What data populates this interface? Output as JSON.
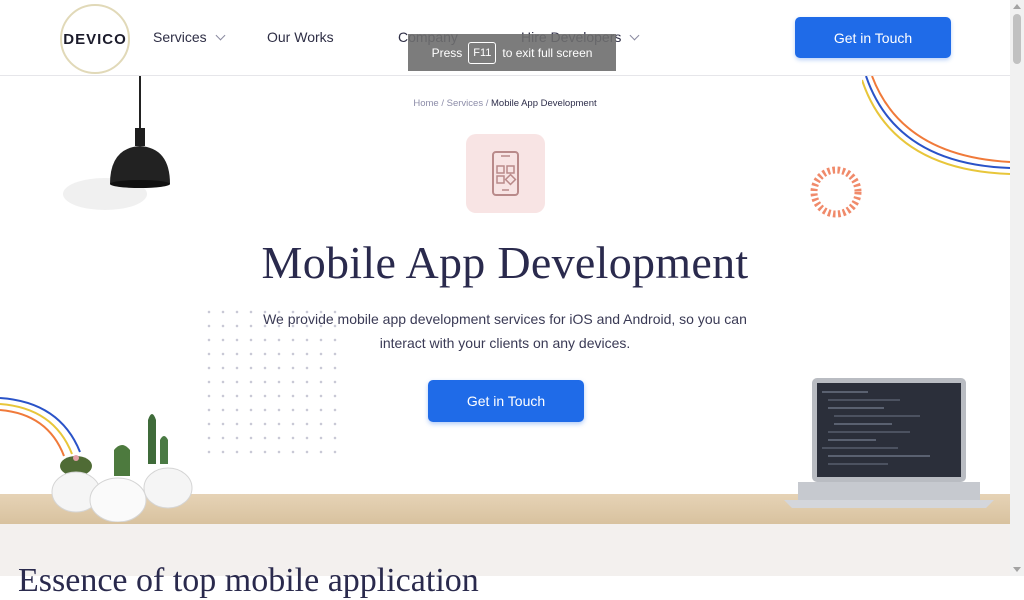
{
  "brand": {
    "logo_text": "DEVICO"
  },
  "nav": {
    "items": [
      {
        "label": "Services",
        "has_dropdown": true
      },
      {
        "label": "Our Works",
        "has_dropdown": false
      },
      {
        "label": "Company",
        "has_dropdown": false
      },
      {
        "label": "Hire Developers",
        "has_dropdown": true
      }
    ],
    "cta_label": "Get in Touch"
  },
  "fullscreen_toast": {
    "prefix": "Press",
    "key": "F11",
    "suffix": "to exit full screen"
  },
  "breadcrumb": {
    "home": "Home",
    "sep": "/",
    "services": "Services",
    "current": "Mobile App Development"
  },
  "hero": {
    "icon": "mobile-app-icon",
    "title": "Mobile App Development",
    "description": "We provide mobile app development services for iOS and Android, so you can interact with your clients on any devices.",
    "cta_label": "Get in Touch"
  },
  "next_section": {
    "heading_partial": "Essence of top mobile application"
  },
  "colors": {
    "accent": "#1f6be8",
    "title": "#2a2a4d",
    "icon_bg": "#f8e4e4",
    "icon_fg": "#b98a8a"
  }
}
